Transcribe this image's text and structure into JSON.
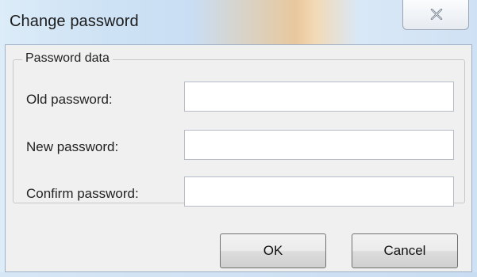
{
  "window": {
    "title": "Change password"
  },
  "group": {
    "legend": "Password data"
  },
  "fields": [
    {
      "label": "Old password:",
      "value": ""
    },
    {
      "label": "New password:",
      "value": ""
    },
    {
      "label": "Confirm password:",
      "value": ""
    }
  ],
  "buttons": {
    "ok": "OK",
    "cancel": "Cancel"
  },
  "icons": {
    "close": "close-icon"
  }
}
